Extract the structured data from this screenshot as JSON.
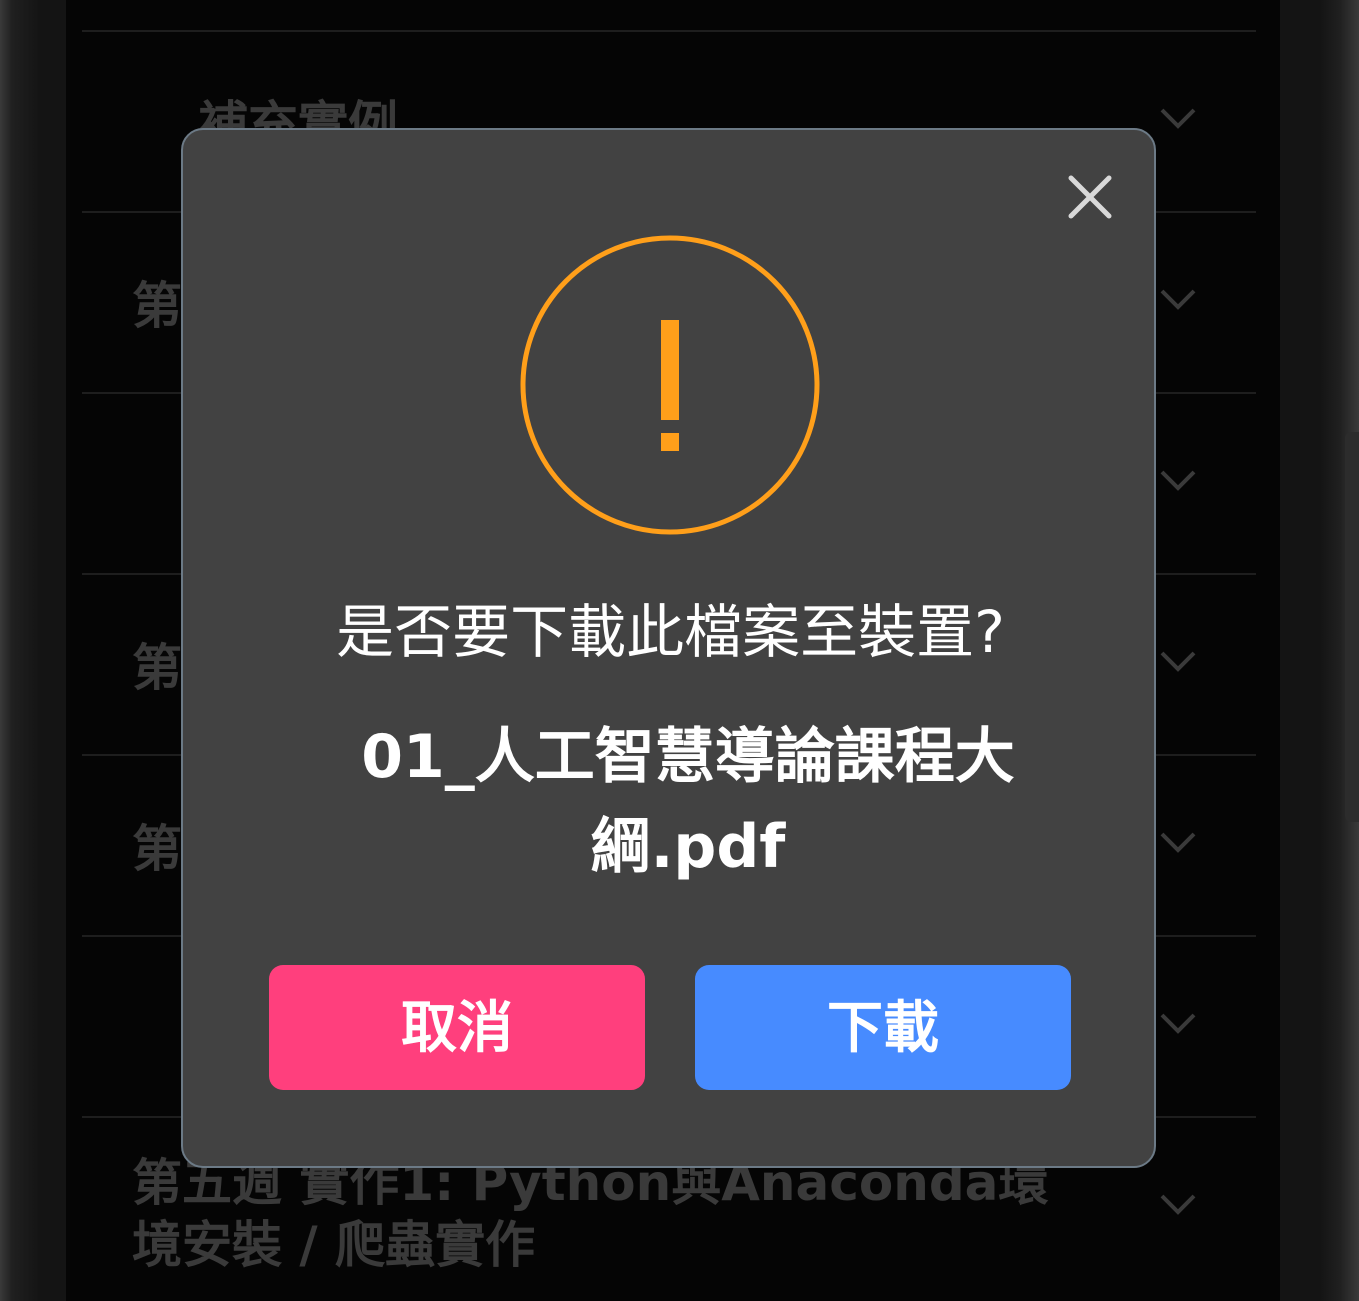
{
  "background_list": {
    "items": [
      {
        "title": "補充實例"
      },
      {
        "title": "第"
      },
      {
        "title": ""
      },
      {
        "title": "第"
      },
      {
        "title": "第"
      },
      {
        "title": ""
      },
      {
        "title": "第五週 實作1: Python與Anaconda環境安裝 / 爬蟲實作"
      }
    ]
  },
  "dialog": {
    "question": "是否要下載此檔案至裝置?",
    "filename": "01_人工智慧導論課程大綱.pdf",
    "cancel_label": "取消",
    "download_label": "下載",
    "icon": "warning-circle-icon",
    "close_icon": "close-icon"
  },
  "colors": {
    "warning": "#ff9f1a",
    "cancel": "#ff3f7d",
    "download": "#478bff",
    "dialog_bg": "#424242"
  }
}
